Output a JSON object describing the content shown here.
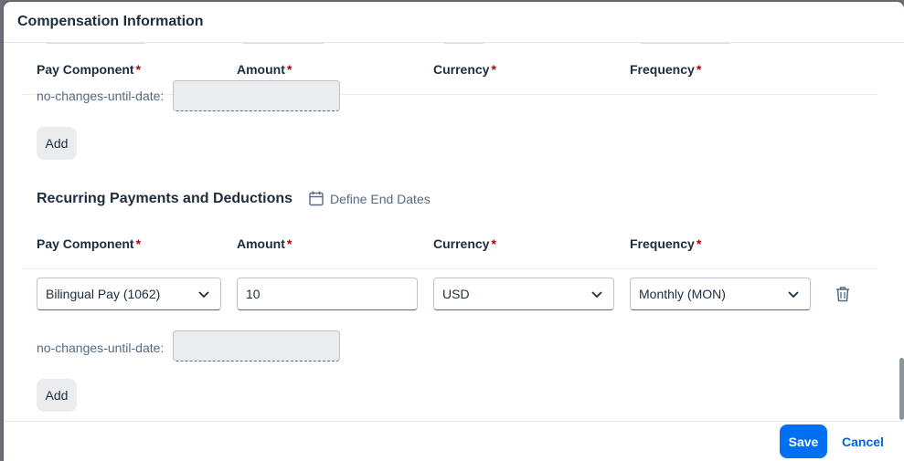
{
  "dialog": {
    "title": "Compensation Information"
  },
  "one_time": {
    "headers": {
      "pay_component": "Pay Component",
      "amount": "Amount",
      "currency": "Currency",
      "frequency": "Frequency",
      "required_mark": "*"
    },
    "no_changes_label": "no-changes-until-date:",
    "add_label": "Add"
  },
  "recurring": {
    "title": "Recurring Payments and Deductions",
    "define_end_dates_label": "Define End Dates",
    "headers": {
      "pay_component": "Pay Component",
      "amount": "Amount",
      "currency": "Currency",
      "frequency": "Frequency",
      "required_mark": "*"
    },
    "row": {
      "pay_component": "Bilingual Pay (1062)",
      "amount": "10",
      "currency": "USD",
      "frequency": "Monthly (MON)"
    },
    "no_changes_label": "no-changes-until-date:",
    "add_label": "Add"
  },
  "footer": {
    "save_label": "Save",
    "cancel_label": "Cancel"
  },
  "colors": {
    "accent": "#0070f2",
    "required": "#aa0808",
    "text": "#1d2d3e"
  },
  "icons": {
    "calendar": "calendar-icon",
    "chevron": "chevron-down-icon",
    "delete": "trash-icon"
  }
}
